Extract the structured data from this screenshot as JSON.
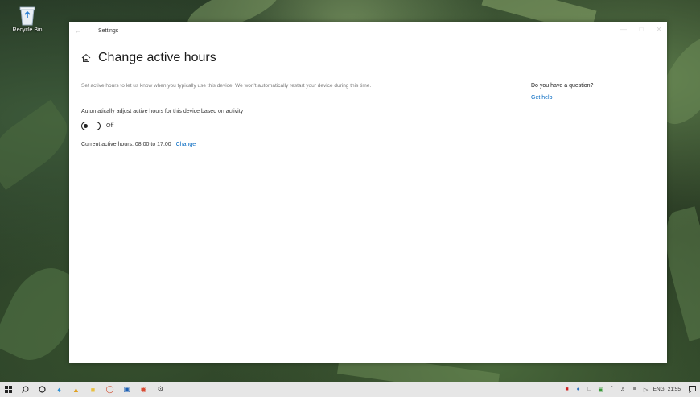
{
  "desktop": {
    "recycle_bin_label": "Recycle Bin"
  },
  "window": {
    "title": "Settings",
    "page_title": "Change active hours",
    "description": "Set active hours to let us know when you typically use this device. We won't automatically restart your device during this time.",
    "auto_adjust_label": "Automatically adjust active hours for this device based on activity",
    "toggle_state": "Off",
    "current_hours": "Current active hours: 08:00 to 17:00",
    "change_link": "Change",
    "question_heading": "Do you have a question?",
    "get_help_link": "Get help"
  },
  "taskbar": {
    "language": "ENG",
    "time": "21:55"
  },
  "colors": {
    "accent": "#0067c0"
  }
}
